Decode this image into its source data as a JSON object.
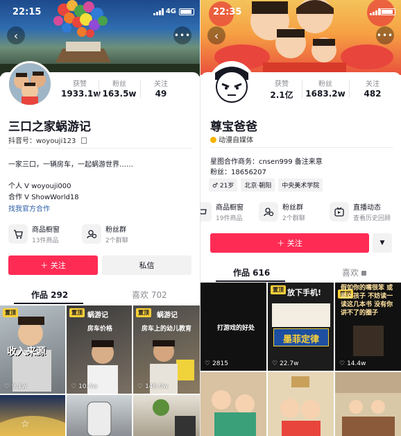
{
  "left": {
    "status": {
      "time": "22:15",
      "network": "4G"
    },
    "stats": [
      {
        "label": "获赞",
        "value": "1933.1w"
      },
      {
        "label": "粉丝",
        "value": "163.5w"
      },
      {
        "label": "关注",
        "value": "49"
      }
    ],
    "name": "三口之家蜗游记",
    "douyin_id": "抖音号：woyouji123",
    "bio_line1": "一家三口，一辆房车，一起蜗游世界……",
    "contact1": "个人 V woyouji000",
    "contact2": "合作 V ShowWorld18",
    "official_link": "找我官方合作",
    "shop": {
      "title": "商品橱窗",
      "sub": "13件商品"
    },
    "fans": {
      "title": "粉丝群",
      "sub": "2个群聊"
    },
    "follow_button": "＋ 关注",
    "message_button": "私信",
    "tabs": [
      "作品 292",
      "喜欢 702"
    ],
    "videos": [
      {
        "pinned": "置顶",
        "caption": "收入来源",
        "likes": "9.1w"
      },
      {
        "pinned": "置顶",
        "title": "蜗游记",
        "caption": "房车价格",
        "likes": "10.4w"
      },
      {
        "pinned": "置顶",
        "title": "蜗游记",
        "caption": "房车上的幼儿教育",
        "likes": "146.0w"
      }
    ]
  },
  "right": {
    "status": {
      "time": "22:35"
    },
    "stats": [
      {
        "label": "获赞",
        "value": "2.1亿"
      },
      {
        "label": "粉丝",
        "value": "1683.2w"
      },
      {
        "label": "关注",
        "value": "482"
      }
    ],
    "name": "尊宝爸爸",
    "badge": "动漫自媒体",
    "biz": "星图合作商务：cnsen999 备注来意",
    "fans_line": "粉丝：18656207",
    "tags": [
      "♂ 21岁",
      "北京·朝阳",
      "中央美术学院"
    ],
    "shop": {
      "title": "商品橱窗",
      "sub": "19件商品"
    },
    "fans": {
      "title": "粉丝群",
      "sub": "2个群聊"
    },
    "live": {
      "title": "直播动态",
      "sub": "查看历史回顾"
    },
    "follow_button": "＋ 关注",
    "tabs": [
      "作品 616",
      "喜欢"
    ],
    "videos": [
      {
        "caption": "打游戏的好处",
        "likes": "2815"
      },
      {
        "pinned": "置顶",
        "caption": "放下手机!",
        "subcaption": "墨菲定律",
        "likes": "22.7w"
      },
      {
        "pinned": "置顶",
        "caption": "假如你的嘴很笨 或是女孩子 不妨读一读这几本书 没有你讲不了的圈子",
        "likes": "14.4w"
      }
    ]
  },
  "colors": {
    "accent": "#fe2c55",
    "pin": "#fbd038",
    "link": "#2b5ea8"
  }
}
